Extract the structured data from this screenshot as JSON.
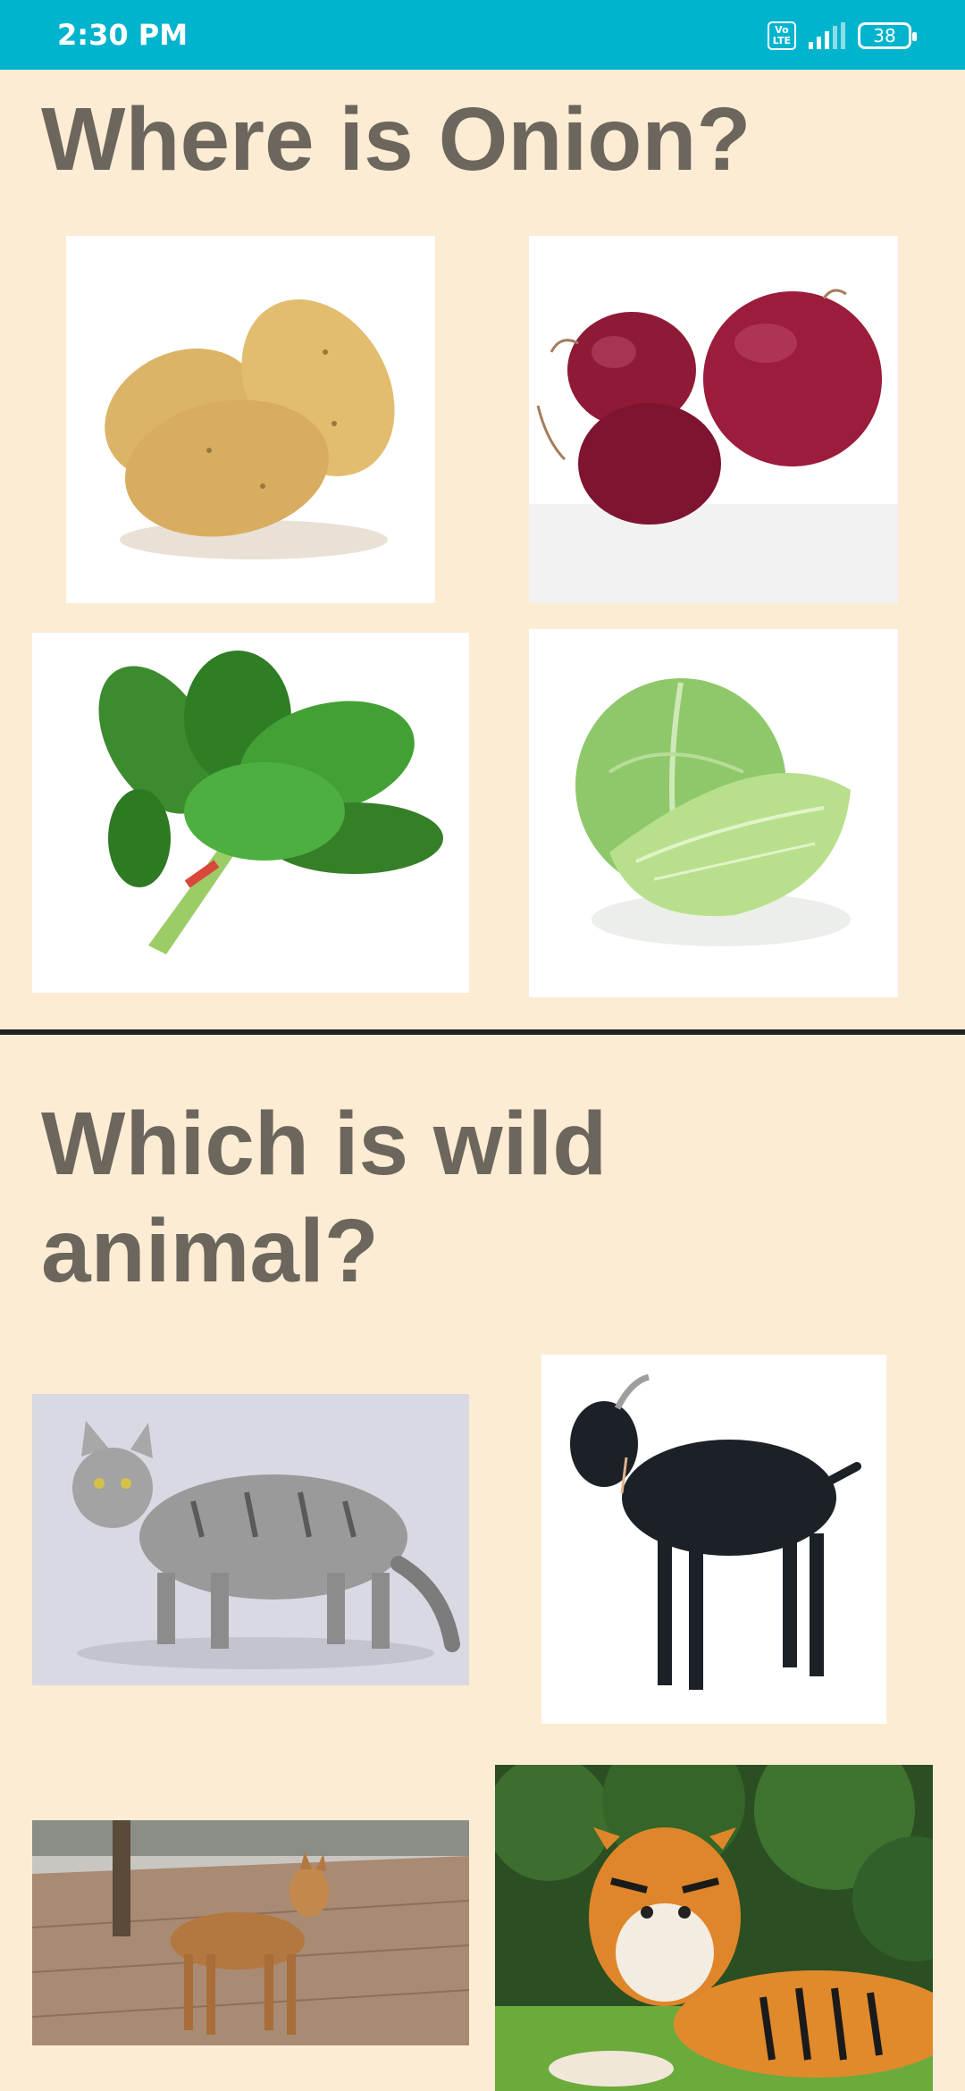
{
  "status_bar": {
    "time": "2:30 PM",
    "network_badge_top": "Vo",
    "network_badge_bottom": "LTE",
    "battery_level": "38",
    "icons": [
      "volte-icon",
      "signal-icon",
      "battery-icon"
    ]
  },
  "quiz": [
    {
      "question": "Where is Onion?",
      "options": [
        {
          "name": "potato",
          "icon": "potato-image"
        },
        {
          "name": "onion",
          "icon": "onion-image"
        },
        {
          "name": "spinach",
          "icon": "spinach-image"
        },
        {
          "name": "cabbage",
          "icon": "cabbage-image"
        }
      ]
    },
    {
      "question": "Which is wild animal?",
      "options": [
        {
          "name": "cat",
          "icon": "cat-image"
        },
        {
          "name": "goat",
          "icon": "goat-image"
        },
        {
          "name": "dog",
          "icon": "dog-image"
        },
        {
          "name": "tiger",
          "icon": "tiger-image"
        }
      ]
    }
  ],
  "colors": {
    "status_bar": "#00b4cd",
    "background": "#fdecd4",
    "question_text": "#6c665d",
    "divider": "#222222"
  }
}
